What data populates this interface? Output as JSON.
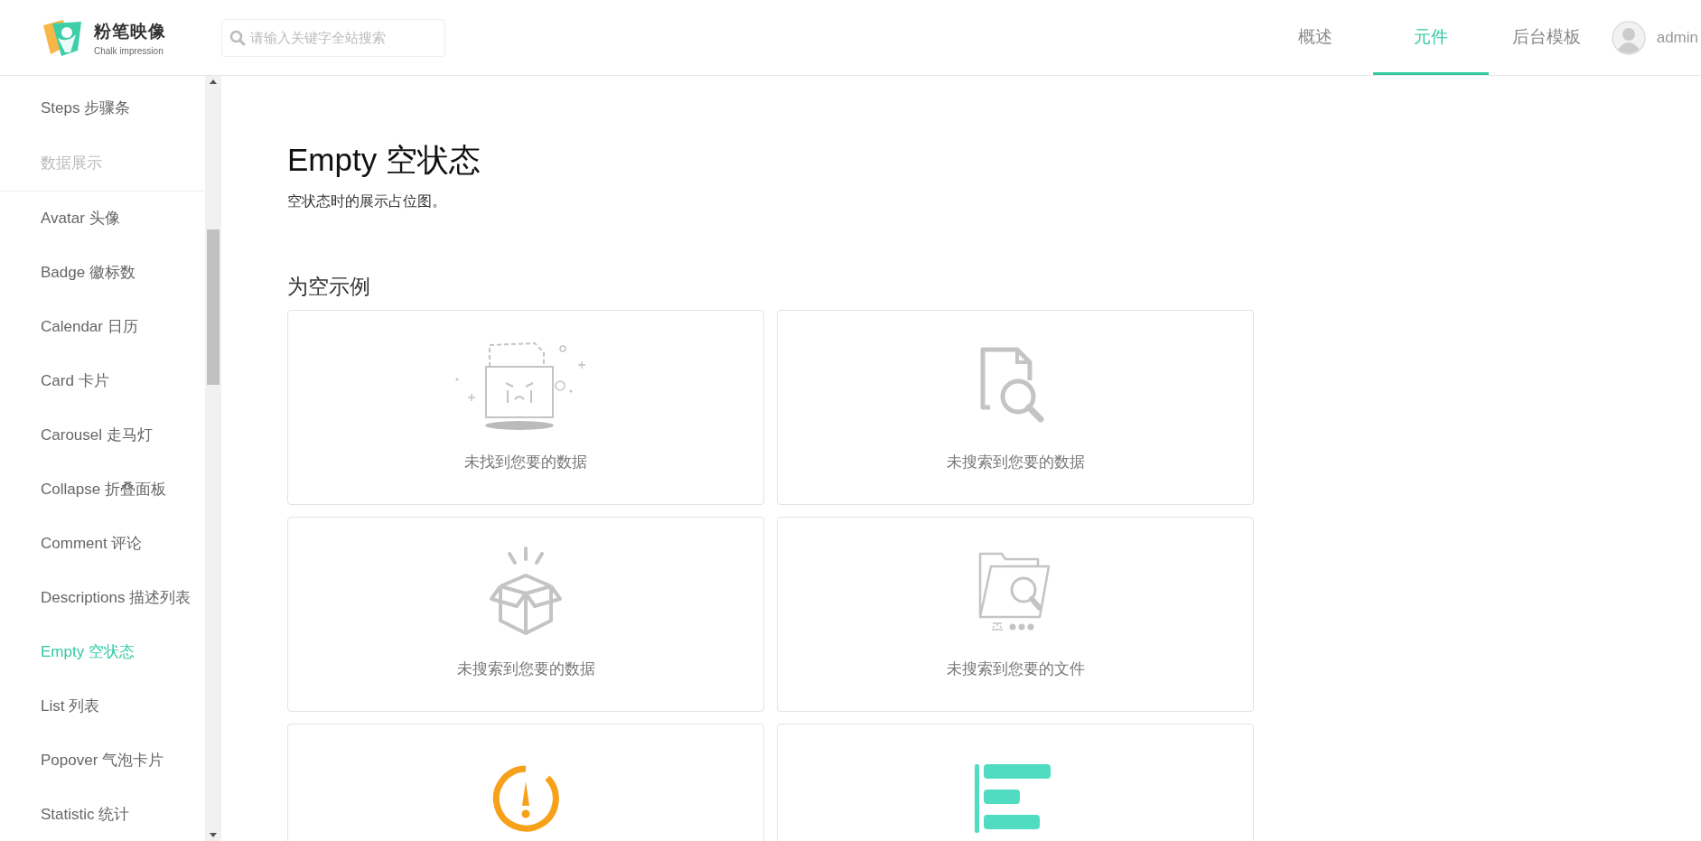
{
  "header": {
    "logo": {
      "title": "粉笔映像",
      "subtitle": "Chalk impression"
    },
    "search": {
      "placeholder": "请输入关键字全站搜索"
    },
    "tabs": [
      {
        "label": "概述",
        "selected": false
      },
      {
        "label": "元件",
        "selected": true
      },
      {
        "label": "后台模板",
        "selected": false
      }
    ],
    "user": {
      "name": "admin"
    }
  },
  "sidebar": {
    "items": [
      {
        "kind": "item",
        "label": "Steps 步骤条",
        "selected": false
      },
      {
        "kind": "group",
        "label": "数据展示"
      },
      {
        "kind": "item",
        "label": "Avatar 头像",
        "selected": false
      },
      {
        "kind": "item",
        "label": "Badge 徽标数",
        "selected": false
      },
      {
        "kind": "item",
        "label": "Calendar 日历",
        "selected": false
      },
      {
        "kind": "item",
        "label": "Card 卡片",
        "selected": false
      },
      {
        "kind": "item",
        "label": "Carousel 走马灯",
        "selected": false
      },
      {
        "kind": "item",
        "label": "Collapse 折叠面板",
        "selected": false
      },
      {
        "kind": "item",
        "label": "Comment 评论",
        "selected": false
      },
      {
        "kind": "item",
        "label": "Descriptions 描述列表",
        "selected": false
      },
      {
        "kind": "item",
        "label": "Empty 空状态",
        "selected": true
      },
      {
        "kind": "item",
        "label": "List 列表",
        "selected": false
      },
      {
        "kind": "item",
        "label": "Popover 气泡卡片",
        "selected": false
      },
      {
        "kind": "item",
        "label": "Statistic 统计",
        "selected": false
      }
    ]
  },
  "content": {
    "title": "Empty 空状态",
    "description": "空状态时的展示占位图。",
    "section": "为空示例",
    "cards": [
      {
        "kind": "crying-folder",
        "caption": "未找到您要的数据"
      },
      {
        "kind": "document-search",
        "caption": "未搜索到您要的数据"
      },
      {
        "kind": "open-box",
        "caption": "未搜索到您要的数据"
      },
      {
        "kind": "folder-search",
        "caption": "未搜索到您要的文件"
      },
      {
        "kind": "warning"
      },
      {
        "kind": "bars"
      }
    ]
  }
}
